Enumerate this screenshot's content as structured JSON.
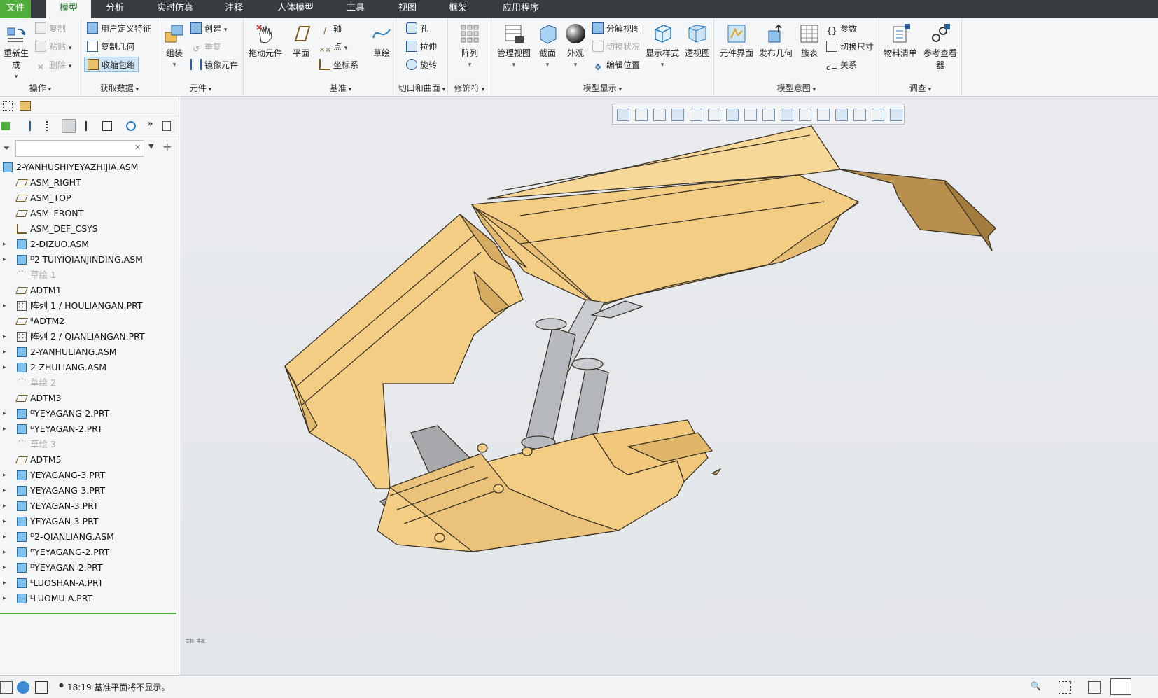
{
  "menu": {
    "tabs": [
      "文件",
      "模型",
      "分析",
      "实时仿真",
      "注释",
      "人体模型",
      "工具",
      "视图",
      "框架",
      "应用程序"
    ],
    "active": "模型"
  },
  "ribbon": {
    "groups": {
      "operations": "操作",
      "get_data": "获取数据",
      "component": "元件",
      "datum": "基准",
      "cuts_surfaces": "切口和曲面",
      "modifiers": "修饰符",
      "model_display": "模型显示",
      "model_intent": "模型意图",
      "investigate": "调查"
    },
    "buttons": {
      "regenerate": "重新生成",
      "copy": "复制",
      "paste": "粘贴",
      "delete": "删除",
      "udf": "用户定义特征",
      "copy_geom": "复制几何",
      "shrinkwrap": "收缩包络",
      "assemble": "组装",
      "create": "创建",
      "repeat": "重复",
      "mirror": "镜像元件",
      "drag": "拖动元件",
      "plane": "平面",
      "axis": "轴",
      "point": "点",
      "csys": "坐标系",
      "sketch": "草绘",
      "hole": "孔",
      "extrude": "拉伸",
      "revolve": "旋转",
      "pattern": "阵列",
      "manage_views": "管理视图",
      "section": "截面",
      "appearance": "外观",
      "explode": "分解视图",
      "toggle_state": "切换状况",
      "edit_pos": "编辑位置",
      "display_style": "显示样式",
      "perspective": "透视图",
      "comp_interface": "元件界面",
      "publish_geom": "发布几何",
      "family_table": "族表",
      "params": "参数",
      "switch_dims": "切换尺寸",
      "relations": "关系",
      "bom": "物料清单",
      "ref_viewer": "参考查看器"
    }
  },
  "tree": {
    "search_placeholder": "",
    "items": [
      {
        "label": "2-YANHUSHIYEYAZHIJIA.ASM",
        "type": "asm",
        "level": 0,
        "exp": false,
        "gray": false
      },
      {
        "label": "ASM_RIGHT",
        "type": "plane",
        "level": 1,
        "exp": false,
        "gray": false
      },
      {
        "label": "ASM_TOP",
        "type": "plane",
        "level": 1,
        "exp": false,
        "gray": false
      },
      {
        "label": "ASM_FRONT",
        "type": "plane",
        "level": 1,
        "exp": false,
        "gray": false
      },
      {
        "label": "ASM_DEF_CSYS",
        "type": "csys",
        "level": 1,
        "exp": false,
        "gray": false
      },
      {
        "label": "2-DIZUO.ASM",
        "type": "asm",
        "level": 1,
        "exp": true,
        "gray": false
      },
      {
        "label": "ᴰ2-TUIYIQIANJINDING.ASM",
        "type": "asm",
        "level": 1,
        "exp": true,
        "gray": false
      },
      {
        "label": "草绘 1",
        "type": "sketch",
        "level": 1,
        "exp": false,
        "gray": true
      },
      {
        "label": "ADTM1",
        "type": "plane",
        "level": 1,
        "exp": false,
        "gray": false
      },
      {
        "label": "阵列 1 / HOULIANGAN.PRT",
        "type": "pattern",
        "level": 1,
        "exp": true,
        "gray": false
      },
      {
        "label": "ᴵᴵADTM2",
        "type": "plane",
        "level": 1,
        "exp": false,
        "gray": false
      },
      {
        "label": "阵列 2 / QIANLIANGAN.PRT",
        "type": "pattern",
        "level": 1,
        "exp": true,
        "gray": false
      },
      {
        "label": "2-YANHULIANG.ASM",
        "type": "asm",
        "level": 1,
        "exp": true,
        "gray": false
      },
      {
        "label": "2-ZHULIANG.ASM",
        "type": "asm",
        "level": 1,
        "exp": true,
        "gray": false
      },
      {
        "label": "草绘 2",
        "type": "sketch",
        "level": 1,
        "exp": false,
        "gray": true
      },
      {
        "label": "ADTM3",
        "type": "plane",
        "level": 1,
        "exp": false,
        "gray": false
      },
      {
        "label": "ᴰYEYAGANG-2.PRT",
        "type": "prt",
        "level": 1,
        "exp": true,
        "gray": false
      },
      {
        "label": "ᴰYEYAGAN-2.PRT",
        "type": "prt",
        "level": 1,
        "exp": true,
        "gray": false
      },
      {
        "label": "草绘 3",
        "type": "sketch",
        "level": 1,
        "exp": false,
        "gray": true
      },
      {
        "label": "ADTM5",
        "type": "plane",
        "level": 1,
        "exp": false,
        "gray": false
      },
      {
        "label": "YEYAGANG-3.PRT",
        "type": "prt",
        "level": 1,
        "exp": true,
        "gray": false
      },
      {
        "label": "YEYAGANG-3.PRT",
        "type": "prt",
        "level": 1,
        "exp": true,
        "gray": false
      },
      {
        "label": "YEYAGAN-3.PRT",
        "type": "prt",
        "level": 1,
        "exp": true,
        "gray": false
      },
      {
        "label": "YEYAGAN-3.PRT",
        "type": "prt",
        "level": 1,
        "exp": true,
        "gray": false
      },
      {
        "label": "ᴰ2-QIANLIANG.ASM",
        "type": "asm",
        "level": 1,
        "exp": true,
        "gray": false
      },
      {
        "label": "ᴰYEYAGANG-2.PRT",
        "type": "prt",
        "level": 1,
        "exp": true,
        "gray": false
      },
      {
        "label": "ᴰYEYAGAN-2.PRT",
        "type": "prt",
        "level": 1,
        "exp": true,
        "gray": false
      },
      {
        "label": "ᴸLUOSHAN-A.PRT",
        "type": "prt",
        "level": 1,
        "exp": true,
        "gray": false
      },
      {
        "label": "ᴸLUOMU-A.PRT",
        "type": "prt",
        "level": 1,
        "exp": true,
        "gray": false
      }
    ]
  },
  "graphics": {
    "corner_note": "支持: 非高"
  },
  "status": {
    "message": "18:19 基准平面将不显示。"
  },
  "colors": {
    "accent_green": "#4fae3a",
    "part_yellow": "#f3cd84",
    "cylinder_gray": "#b9bdc1"
  }
}
